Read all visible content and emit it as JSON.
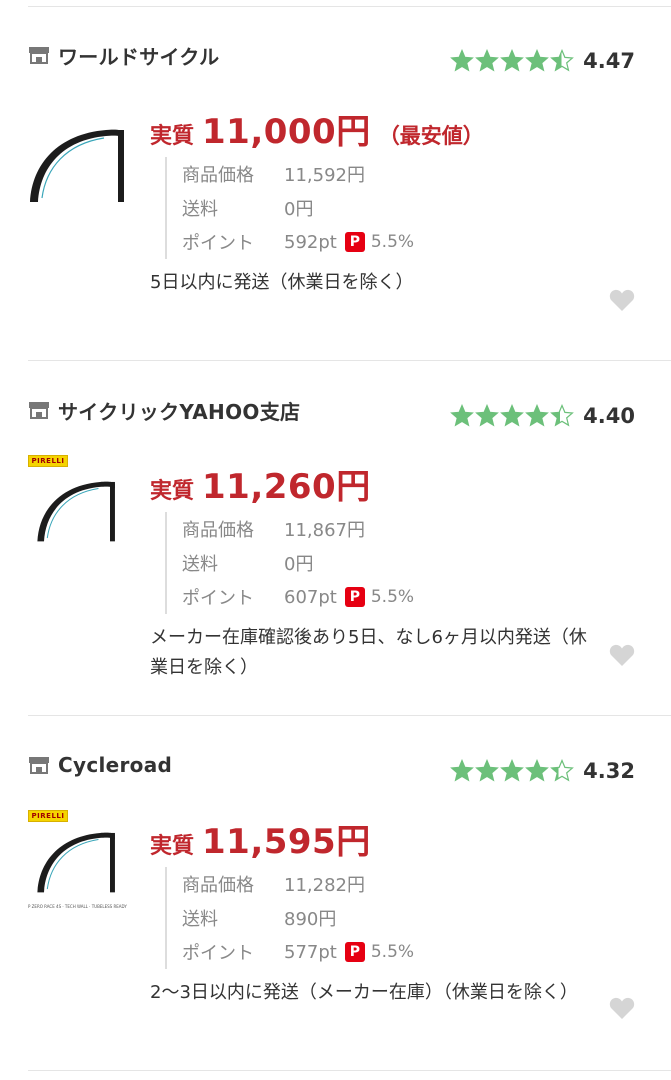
{
  "offers": [
    {
      "shop_name": "ワールドサイクル",
      "rating": "4.47",
      "rating_value": 4.47,
      "price_label": "実質",
      "price": "11,000円",
      "price_note": "（最安値）",
      "details": [
        {
          "label": "商品価格",
          "value": "11,592円"
        },
        {
          "label": "送料",
          "value": "0円"
        },
        {
          "label": "ポイント",
          "value": "592pt",
          "paypay": "P",
          "percent": "5.5%"
        }
      ],
      "shipping": "5日以内に発送（休業日を除く）"
    },
    {
      "shop_name": "サイクリックYAHOO支店",
      "rating": "4.40",
      "rating_value": 4.4,
      "brand_logo": "PIRELLI",
      "price_label": "実質",
      "price": "11,260円",
      "price_note": "",
      "details": [
        {
          "label": "商品価格",
          "value": "11,867円"
        },
        {
          "label": "送料",
          "value": "0円"
        },
        {
          "label": "ポイント",
          "value": "607pt",
          "paypay": "P",
          "percent": "5.5%"
        }
      ],
      "shipping": "メーカー在庫確認後あり5日、なし6ヶ月以内発送（休業日を除く）"
    },
    {
      "shop_name": "Cycleroad",
      "rating": "4.32",
      "rating_value": 4.32,
      "brand_logo": "PIRELLI",
      "image_caption": "P ZERO RACE 4S · TECH WALL · TUBELESS READY",
      "price_label": "実質",
      "price": "11,595円",
      "price_note": "",
      "details": [
        {
          "label": "商品価格",
          "value": "11,282円"
        },
        {
          "label": "送料",
          "value": "890円"
        },
        {
          "label": "ポイント",
          "value": "577pt",
          "paypay": "P",
          "percent": "5.5%"
        }
      ],
      "shipping": "2〜3日以内に発送（メーカー在庫）（休業日を除く）"
    }
  ],
  "colors": {
    "price": "#c0272d",
    "star": "#6cc07a",
    "paypay": "#e60012"
  }
}
